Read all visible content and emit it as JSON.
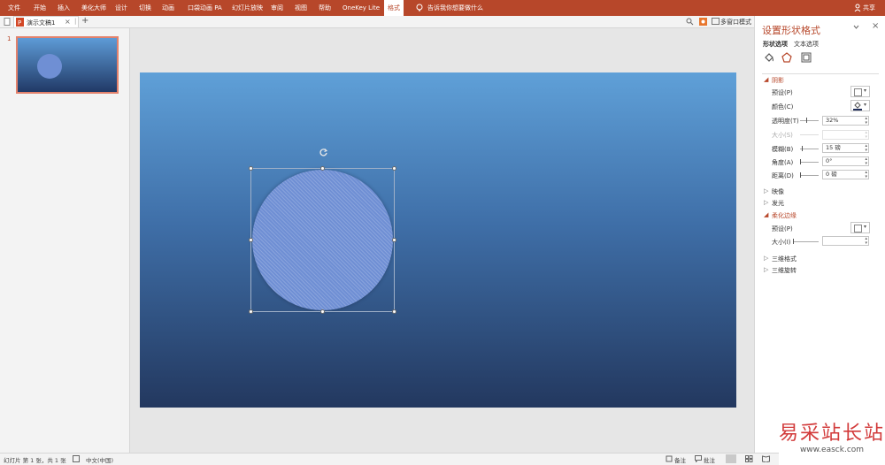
{
  "ribbon": {
    "tabs": [
      "文件",
      "开始",
      "插入",
      "美化大师",
      "设计",
      "切换",
      "动画",
      "口袋动画 PA",
      "幻灯片放映",
      "审阅",
      "视图",
      "帮助",
      "OneKey Lite",
      "格式"
    ],
    "tellme": "告诉我你想要做什么",
    "share": "共享",
    "accent": "#b7472a"
  },
  "docbar": {
    "doc_name": "演示文稿1",
    "close": "×",
    "add": "+",
    "multiwindow": "多窗口模式"
  },
  "thumbs": {
    "slide_number": "1"
  },
  "panel": {
    "title": "设置形状格式",
    "subtab_shape": "形状选项",
    "subtab_text": "文本选项",
    "shadow": {
      "header": "阴影",
      "preset": "预设(P)",
      "color": "颜色(C)",
      "transparency": "透明度(T)",
      "transparency_value": "32%",
      "size": "大小(S)",
      "blur": "模糊(B)",
      "blur_value": "15 磅",
      "angle": "角度(A)",
      "angle_value": "0°",
      "distance": "距离(D)",
      "distance_value": "0 磅"
    },
    "reflection": "映像",
    "glow": "发光",
    "soft_edges": {
      "header": "柔化边缘",
      "preset": "预设(P)",
      "size": "大小(I)",
      "size_value": ""
    },
    "format3d": "三维格式",
    "rotation3d": "三维旋转"
  },
  "status": {
    "slide_info": "幻灯片 第 1 张，共 1 张",
    "language": "中文(中国)",
    "notes": "备注",
    "comments": "批注"
  },
  "watermark": {
    "text": "易采站长站",
    "url": "www.easck.com"
  }
}
